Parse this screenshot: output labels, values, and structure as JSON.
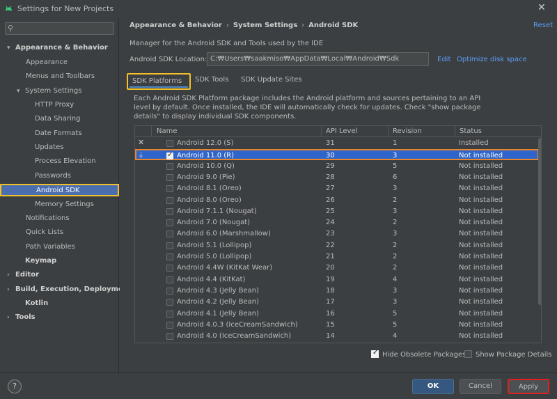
{
  "window": {
    "title": "Settings for New Projects",
    "close": "✕"
  },
  "sidebar": {
    "search_placeholder": "",
    "items": [
      {
        "label": "Appearance & Behavior",
        "arrow": "▾",
        "bold": true
      },
      {
        "label": "Appearance"
      },
      {
        "label": "Menus and Toolbars"
      },
      {
        "label": "System Settings",
        "arrow": "▾"
      },
      {
        "label": "HTTP Proxy"
      },
      {
        "label": "Data Sharing"
      },
      {
        "label": "Date Formats"
      },
      {
        "label": "Updates"
      },
      {
        "label": "Process Elevation"
      },
      {
        "label": "Passwords"
      },
      {
        "label": "Android SDK",
        "selected": true
      },
      {
        "label": "Memory Settings"
      },
      {
        "label": "Notifications"
      },
      {
        "label": "Quick Lists"
      },
      {
        "label": "Path Variables"
      },
      {
        "label": "Keymap",
        "bold": true
      },
      {
        "label": "Editor",
        "arrow": "›",
        "bold": true
      },
      {
        "label": "Build, Execution, Deployment",
        "arrow": "›",
        "bold": true
      },
      {
        "label": "Kotlin",
        "bold": true
      },
      {
        "label": "Tools",
        "arrow": "›",
        "bold": true
      }
    ]
  },
  "breadcrumb": {
    "a": "Appearance & Behavior",
    "b": "System Settings",
    "c": "Android SDK",
    "sep": "›"
  },
  "reset_label": "Reset",
  "description": "Manager for the Android SDK and Tools used by the IDE",
  "location": {
    "label": "Android SDK Location:",
    "value": "C:₩Users₩saakmiso₩AppData₩Local₩Android₩Sdk",
    "edit": "Edit",
    "optimize": "Optimize disk space"
  },
  "tabs": {
    "platforms": "SDK Platforms",
    "tools": "SDK Tools",
    "sites": "SDK Update Sites"
  },
  "platform_desc": "Each Android SDK Platform package includes the Android platform and sources pertaining to an API level by default. Once installed, the IDE will automatically check for updates. Check \"show package details\" to display individual SDK components.",
  "table": {
    "headers": {
      "name": "Name",
      "api": "API Level",
      "revision": "Revision",
      "status": "Status"
    },
    "rows": [
      {
        "icon": "✕",
        "checked": false,
        "name": "Android 12.0 (S)",
        "api": "31",
        "revision": "1",
        "status": "Installed"
      },
      {
        "icon": "⤓",
        "checked": true,
        "selected": true,
        "name": "Android 11.0 (R)",
        "api": "30",
        "revision": "3",
        "status": "Not installed"
      },
      {
        "icon": "",
        "checked": false,
        "name": "Android 10.0 (Q)",
        "api": "29",
        "revision": "5",
        "status": "Not installed"
      },
      {
        "icon": "",
        "checked": false,
        "name": "Android 9.0 (Pie)",
        "api": "28",
        "revision": "6",
        "status": "Not installed"
      },
      {
        "icon": "",
        "checked": false,
        "name": "Android 8.1 (Oreo)",
        "api": "27",
        "revision": "3",
        "status": "Not installed"
      },
      {
        "icon": "",
        "checked": false,
        "name": "Android 8.0 (Oreo)",
        "api": "26",
        "revision": "2",
        "status": "Not installed"
      },
      {
        "icon": "",
        "checked": false,
        "name": "Android 7.1.1 (Nougat)",
        "api": "25",
        "revision": "3",
        "status": "Not installed"
      },
      {
        "icon": "",
        "checked": false,
        "name": "Android 7.0 (Nougat)",
        "api": "24",
        "revision": "2",
        "status": "Not installed"
      },
      {
        "icon": "",
        "checked": false,
        "name": "Android 6.0 (Marshmallow)",
        "api": "23",
        "revision": "3",
        "status": "Not installed"
      },
      {
        "icon": "",
        "checked": false,
        "name": "Android 5.1 (Lollipop)",
        "api": "22",
        "revision": "2",
        "status": "Not installed"
      },
      {
        "icon": "",
        "checked": false,
        "name": "Android 5.0 (Lollipop)",
        "api": "21",
        "revision": "2",
        "status": "Not installed"
      },
      {
        "icon": "",
        "checked": false,
        "name": "Android 4.4W (KitKat Wear)",
        "api": "20",
        "revision": "2",
        "status": "Not installed"
      },
      {
        "icon": "",
        "checked": false,
        "name": "Android 4.4 (KitKat)",
        "api": "19",
        "revision": "4",
        "status": "Not installed"
      },
      {
        "icon": "",
        "checked": false,
        "name": "Android 4.3 (Jelly Bean)",
        "api": "18",
        "revision": "3",
        "status": "Not installed"
      },
      {
        "icon": "",
        "checked": false,
        "name": "Android 4.2 (Jelly Bean)",
        "api": "17",
        "revision": "3",
        "status": "Not installed"
      },
      {
        "icon": "",
        "checked": false,
        "name": "Android 4.1 (Jelly Bean)",
        "api": "16",
        "revision": "5",
        "status": "Not installed"
      },
      {
        "icon": "",
        "checked": false,
        "name": "Android 4.0.3 (IceCreamSandwich)",
        "api": "15",
        "revision": "5",
        "status": "Not installed"
      },
      {
        "icon": "",
        "checked": false,
        "name": "Android 4.0 (IceCreamSandwich)",
        "api": "14",
        "revision": "4",
        "status": "Not installed"
      }
    ]
  },
  "options": {
    "hide_obsolete": "Hide Obsolete Packages",
    "show_details": "Show Package Details"
  },
  "footer": {
    "help": "?",
    "ok": "OK",
    "cancel": "Cancel",
    "apply": "Apply"
  }
}
